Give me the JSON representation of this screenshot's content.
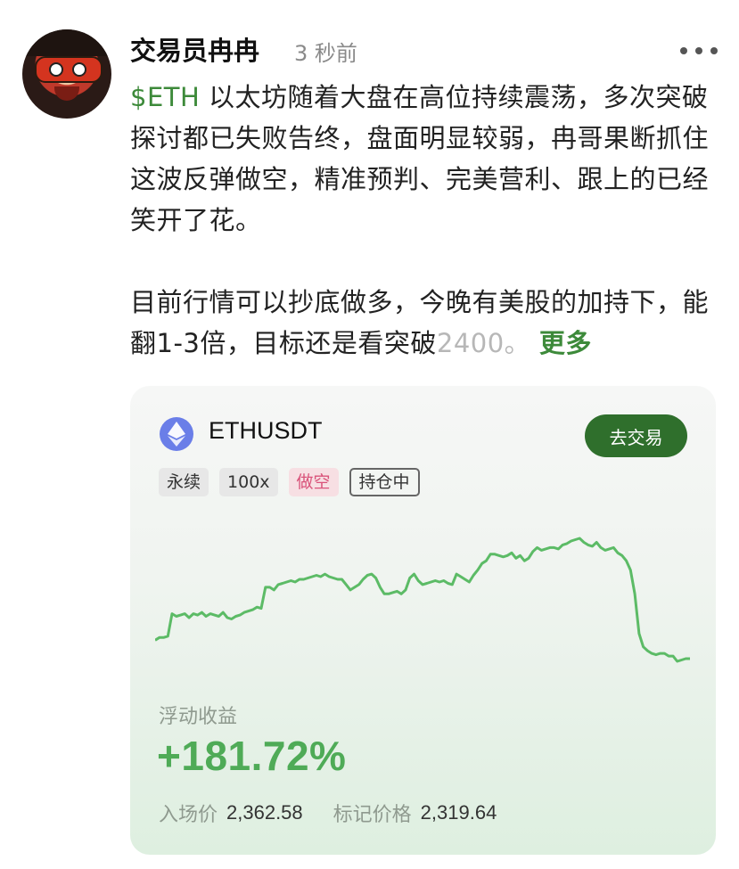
{
  "post": {
    "author": "交易员冉冉",
    "time": "3 秒前",
    "ticker": "$ETH",
    "para1_rest": " 以太坊随着大盘在高位持续震荡，多次突破探讨都已失败告终，盘面明显较弱，冉哥果断抓住这波反弹做空，精准预判、完美营利、跟上的已经笑开了花。",
    "para2_main": "目前行情可以抄底做多，今晚有美股的加持下，能翻1-3倍，目标还是看突破",
    "para2_fade": "2400。",
    "more_label": "更多"
  },
  "card": {
    "pair": "ETHUSDT",
    "trade_button": "去交易",
    "tags": [
      "永续",
      "100x",
      "做空",
      "持仓中"
    ],
    "pnl_label": "浮动收益",
    "pnl_value": "+181.72%",
    "entry_label": "入场价",
    "entry_value": "2,362.58",
    "mark_label": "标记价格",
    "mark_value": "2,319.64"
  },
  "colors": {
    "accent_green": "#3d8a3a",
    "pnl_green": "#4fab57",
    "short_red": "#d9537a",
    "eth_icon": "#6a7ee8"
  },
  "icons": {
    "avatar": "cartoon-avatar",
    "menu": "more-dots-icon",
    "coin": "ethereum-icon"
  },
  "chart_data": {
    "type": "line",
    "series": [
      {
        "values": [
          20,
          22,
          22,
          23,
          40,
          38,
          39,
          40,
          37,
          40,
          39,
          41,
          38,
          40,
          39,
          38,
          41,
          37,
          36,
          38,
          39,
          41,
          42,
          43,
          45,
          44,
          60,
          60,
          58,
          62,
          63,
          64,
          65,
          64,
          66,
          66,
          67,
          68,
          69,
          68,
          70,
          68,
          67,
          66,
          66,
          62,
          58,
          60,
          62,
          66,
          69,
          70,
          67,
          60,
          55,
          55,
          56,
          57,
          55,
          58,
          67,
          70,
          65,
          62,
          63,
          64,
          65,
          64,
          65,
          63,
          62,
          70,
          68,
          66,
          64,
          69,
          73,
          78,
          80,
          85,
          85,
          84,
          83,
          84,
          86,
          82,
          84,
          80,
          82,
          87,
          90,
          88,
          89,
          90,
          90,
          89,
          92,
          93,
          95,
          96,
          97,
          94,
          92,
          91,
          94,
          90,
          88,
          89,
          90,
          86,
          84,
          80,
          73,
          55,
          25,
          15,
          12,
          10,
          9,
          10,
          10,
          8,
          8,
          4,
          5,
          6,
          6
        ]
      }
    ],
    "color": "#5cbb66"
  }
}
